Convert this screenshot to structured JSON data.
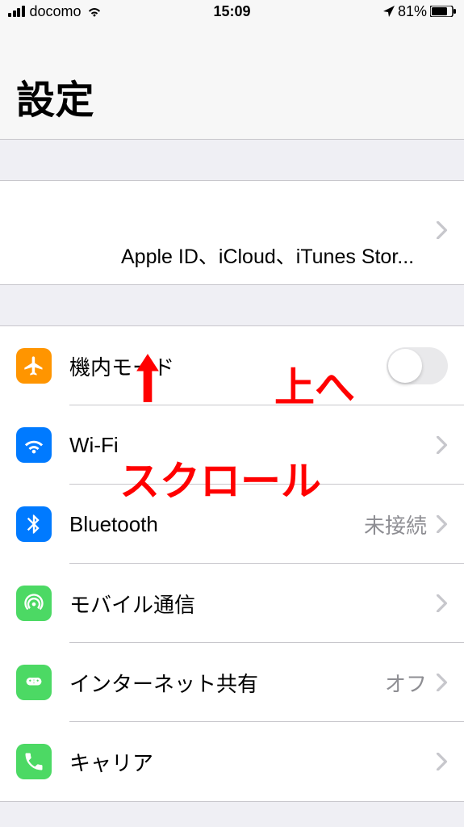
{
  "status_bar": {
    "carrier": "docomo",
    "time": "15:09",
    "battery": "81%"
  },
  "header": {
    "title": "設定"
  },
  "apple_id": {
    "label": "Apple ID、iCloud、iTunes Stor..."
  },
  "settings": {
    "airplane": {
      "label": "機内モード",
      "color": "#ff9500"
    },
    "wifi": {
      "label": "Wi-Fi",
      "color": "#007aff"
    },
    "bluetooth": {
      "label": "Bluetooth",
      "detail": "未接続",
      "color": "#007aff"
    },
    "cellular": {
      "label": "モバイル通信",
      "color": "#4cd964"
    },
    "hotspot": {
      "label": "インターネット共有",
      "detail": "オフ",
      "color": "#4cd964"
    },
    "carrier_row": {
      "label": "キャリア",
      "color": "#4cd964"
    }
  },
  "annotations": {
    "up": "上へ",
    "scroll": "スクロール"
  }
}
